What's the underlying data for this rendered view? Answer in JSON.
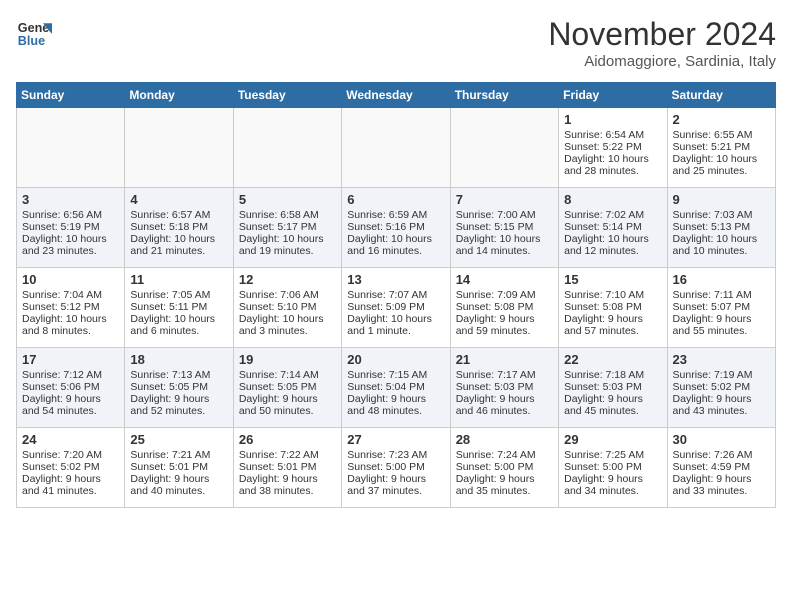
{
  "logo": {
    "line1": "General",
    "line2": "Blue"
  },
  "title": "November 2024",
  "subtitle": "Aidomaggiore, Sardinia, Italy",
  "days_of_week": [
    "Sunday",
    "Monday",
    "Tuesday",
    "Wednesday",
    "Thursday",
    "Friday",
    "Saturday"
  ],
  "weeks": [
    [
      {
        "day": "",
        "info": ""
      },
      {
        "day": "",
        "info": ""
      },
      {
        "day": "",
        "info": ""
      },
      {
        "day": "",
        "info": ""
      },
      {
        "day": "",
        "info": ""
      },
      {
        "day": "1",
        "info": "Sunrise: 6:54 AM\nSunset: 5:22 PM\nDaylight: 10 hours\nand 28 minutes."
      },
      {
        "day": "2",
        "info": "Sunrise: 6:55 AM\nSunset: 5:21 PM\nDaylight: 10 hours\nand 25 minutes."
      }
    ],
    [
      {
        "day": "3",
        "info": "Sunrise: 6:56 AM\nSunset: 5:19 PM\nDaylight: 10 hours\nand 23 minutes."
      },
      {
        "day": "4",
        "info": "Sunrise: 6:57 AM\nSunset: 5:18 PM\nDaylight: 10 hours\nand 21 minutes."
      },
      {
        "day": "5",
        "info": "Sunrise: 6:58 AM\nSunset: 5:17 PM\nDaylight: 10 hours\nand 19 minutes."
      },
      {
        "day": "6",
        "info": "Sunrise: 6:59 AM\nSunset: 5:16 PM\nDaylight: 10 hours\nand 16 minutes."
      },
      {
        "day": "7",
        "info": "Sunrise: 7:00 AM\nSunset: 5:15 PM\nDaylight: 10 hours\nand 14 minutes."
      },
      {
        "day": "8",
        "info": "Sunrise: 7:02 AM\nSunset: 5:14 PM\nDaylight: 10 hours\nand 12 minutes."
      },
      {
        "day": "9",
        "info": "Sunrise: 7:03 AM\nSunset: 5:13 PM\nDaylight: 10 hours\nand 10 minutes."
      }
    ],
    [
      {
        "day": "10",
        "info": "Sunrise: 7:04 AM\nSunset: 5:12 PM\nDaylight: 10 hours\nand 8 minutes."
      },
      {
        "day": "11",
        "info": "Sunrise: 7:05 AM\nSunset: 5:11 PM\nDaylight: 10 hours\nand 6 minutes."
      },
      {
        "day": "12",
        "info": "Sunrise: 7:06 AM\nSunset: 5:10 PM\nDaylight: 10 hours\nand 3 minutes."
      },
      {
        "day": "13",
        "info": "Sunrise: 7:07 AM\nSunset: 5:09 PM\nDaylight: 10 hours\nand 1 minute."
      },
      {
        "day": "14",
        "info": "Sunrise: 7:09 AM\nSunset: 5:08 PM\nDaylight: 9 hours\nand 59 minutes."
      },
      {
        "day": "15",
        "info": "Sunrise: 7:10 AM\nSunset: 5:08 PM\nDaylight: 9 hours\nand 57 minutes."
      },
      {
        "day": "16",
        "info": "Sunrise: 7:11 AM\nSunset: 5:07 PM\nDaylight: 9 hours\nand 55 minutes."
      }
    ],
    [
      {
        "day": "17",
        "info": "Sunrise: 7:12 AM\nSunset: 5:06 PM\nDaylight: 9 hours\nand 54 minutes."
      },
      {
        "day": "18",
        "info": "Sunrise: 7:13 AM\nSunset: 5:05 PM\nDaylight: 9 hours\nand 52 minutes."
      },
      {
        "day": "19",
        "info": "Sunrise: 7:14 AM\nSunset: 5:05 PM\nDaylight: 9 hours\nand 50 minutes."
      },
      {
        "day": "20",
        "info": "Sunrise: 7:15 AM\nSunset: 5:04 PM\nDaylight: 9 hours\nand 48 minutes."
      },
      {
        "day": "21",
        "info": "Sunrise: 7:17 AM\nSunset: 5:03 PM\nDaylight: 9 hours\nand 46 minutes."
      },
      {
        "day": "22",
        "info": "Sunrise: 7:18 AM\nSunset: 5:03 PM\nDaylight: 9 hours\nand 45 minutes."
      },
      {
        "day": "23",
        "info": "Sunrise: 7:19 AM\nSunset: 5:02 PM\nDaylight: 9 hours\nand 43 minutes."
      }
    ],
    [
      {
        "day": "24",
        "info": "Sunrise: 7:20 AM\nSunset: 5:02 PM\nDaylight: 9 hours\nand 41 minutes."
      },
      {
        "day": "25",
        "info": "Sunrise: 7:21 AM\nSunset: 5:01 PM\nDaylight: 9 hours\nand 40 minutes."
      },
      {
        "day": "26",
        "info": "Sunrise: 7:22 AM\nSunset: 5:01 PM\nDaylight: 9 hours\nand 38 minutes."
      },
      {
        "day": "27",
        "info": "Sunrise: 7:23 AM\nSunset: 5:00 PM\nDaylight: 9 hours\nand 37 minutes."
      },
      {
        "day": "28",
        "info": "Sunrise: 7:24 AM\nSunset: 5:00 PM\nDaylight: 9 hours\nand 35 minutes."
      },
      {
        "day": "29",
        "info": "Sunrise: 7:25 AM\nSunset: 5:00 PM\nDaylight: 9 hours\nand 34 minutes."
      },
      {
        "day": "30",
        "info": "Sunrise: 7:26 AM\nSunset: 4:59 PM\nDaylight: 9 hours\nand 33 minutes."
      }
    ]
  ]
}
